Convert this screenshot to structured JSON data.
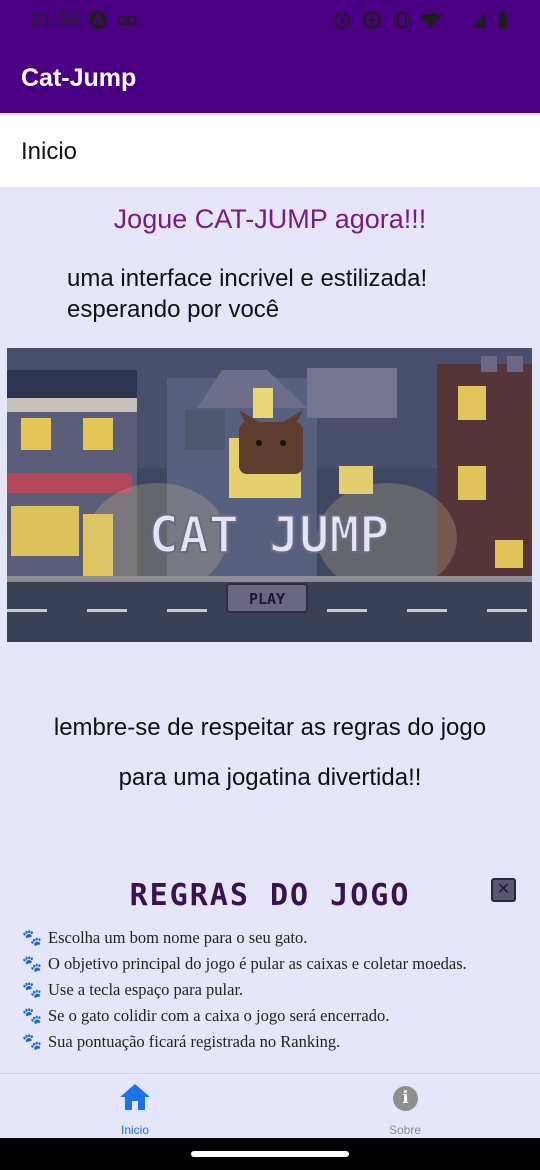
{
  "status_bar": {
    "time": "21:34",
    "icons": [
      "a-badge-icon",
      "voicemail-icon",
      "alarm-icon",
      "data-saver-icon",
      "vibrate-icon",
      "wifi-icon",
      "signal-icon",
      "battery-icon"
    ]
  },
  "app_bar": {
    "title": "Cat-Jump"
  },
  "page_header": {
    "label": "Inicio"
  },
  "content": {
    "headline": "Jogue CAT-JUMP agora!!!",
    "subtitle_line1": "uma interface incrivel e estilizada!",
    "subtitle_line2": "esperando por você",
    "game_art": {
      "logo_text": "CAT JUMP",
      "play_label": "PLAY"
    },
    "reminder_line1": "lembre-se de respeitar as regras do jogo",
    "reminder_line2": "para uma jogatina divertida!!"
  },
  "rules": {
    "title": "REGRAS DO JOGO",
    "items": [
      "Escolha um bom nome para o seu gato.",
      "O objetivo principal do jogo é pular as caixas e coletar moedas.",
      "Use a tecla espaço para pular.",
      "Se o gato colidir com a caixa o jogo será encerrado.",
      "Sua pontuação ficará registrada no Ranking."
    ]
  },
  "bottom_nav": {
    "items": [
      {
        "label": "Inicio",
        "icon": "home-icon",
        "active": true
      },
      {
        "label": "Sobre",
        "icon": "info-icon",
        "active": false
      }
    ]
  },
  "colors": {
    "primary": "#4b0084",
    "background": "#e6e6fa",
    "headline": "#7a1a87",
    "active_nav": "#1a73e8"
  }
}
